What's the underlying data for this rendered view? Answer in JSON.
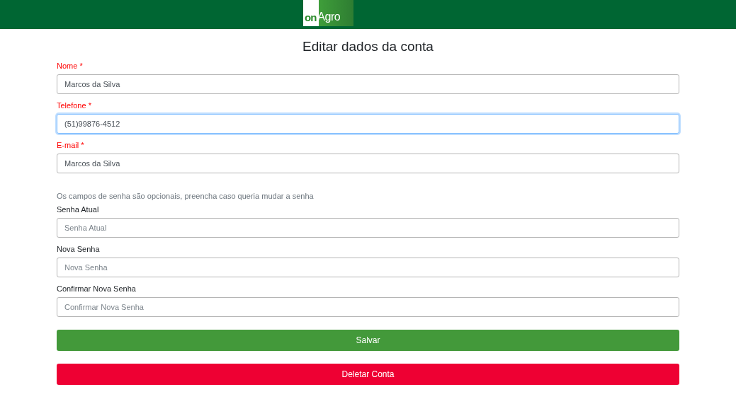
{
  "header": {
    "logo": {
      "mark": "on",
      "word": "Agro"
    }
  },
  "title": "Editar dados da conta",
  "account_fields": [
    {
      "label": "Nome *",
      "value": "Marcos da Silva",
      "required": true,
      "focused": false
    },
    {
      "label": "Telefone *",
      "value": "(51)99876-4512",
      "required": true,
      "focused": true
    },
    {
      "label": "E-mail *",
      "value": "Marcos da Silva",
      "required": true,
      "focused": false
    }
  ],
  "password_note": "Os campos de senha são opcionais, preencha caso queria mudar a senha",
  "password_fields": [
    {
      "label": "Senha Atual",
      "placeholder": "Senha Atual",
      "required": false,
      "focused": false
    },
    {
      "label": "Nova Senha",
      "placeholder": "Nova Senha",
      "required": false,
      "focused": false
    },
    {
      "label": "Confirmar Nova Senha",
      "placeholder": "Confirmar Nova Senha",
      "required": false,
      "focused": false
    }
  ],
  "buttons": [
    {
      "label": "Salvar",
      "kind": "primary"
    },
    {
      "label": "Deletar Conta",
      "kind": "danger"
    }
  ]
}
